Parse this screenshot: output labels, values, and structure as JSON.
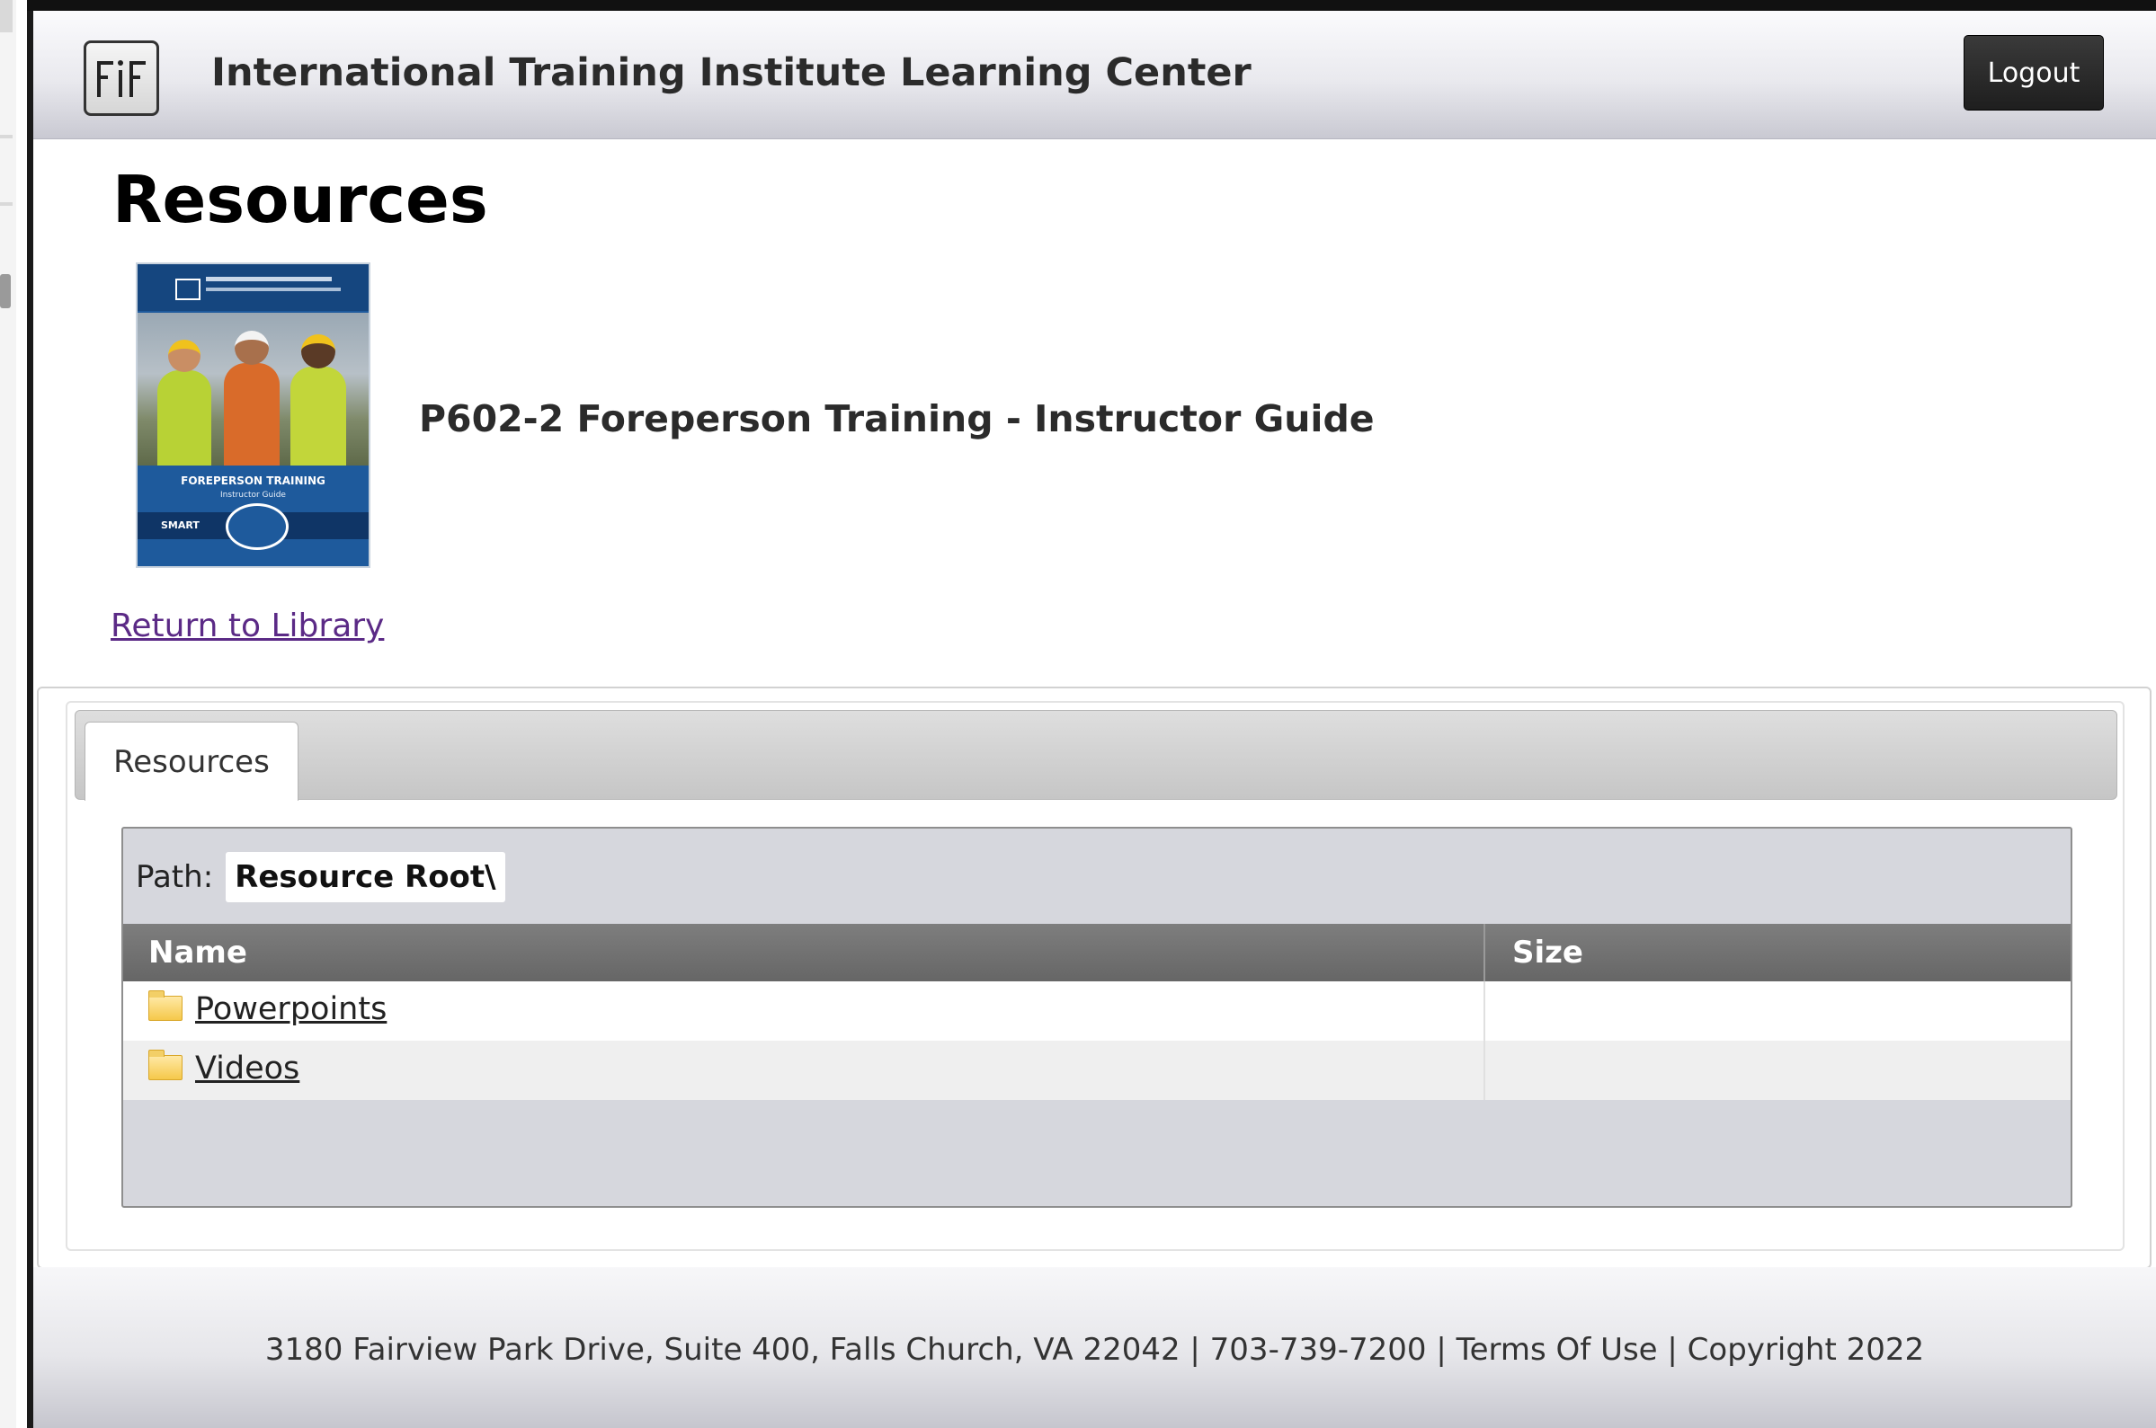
{
  "header": {
    "logo_text": "ITI",
    "title": "International Training Institute Learning Center",
    "logout_label": "Logout"
  },
  "page": {
    "title": "Resources",
    "book_title": "P602-2 Foreperson Training - Instructor Guide",
    "return_link": "Return to Library"
  },
  "cover": {
    "title": "FOREPERSON TRAINING",
    "subtitle": "Instructor Guide",
    "brand": "SMART"
  },
  "tabs": [
    {
      "label": "Resources",
      "active": true
    }
  ],
  "explorer": {
    "path_label": "Path:",
    "path_value": "Resource Root\\",
    "columns": [
      "Name",
      "Size"
    ],
    "rows": [
      {
        "name": "Powerpoints",
        "type": "folder",
        "size": ""
      },
      {
        "name": "Videos",
        "type": "folder",
        "size": ""
      }
    ]
  },
  "footer": {
    "text": "3180 Fairview Park Drive, Suite 400, Falls Church, VA 22042 | 703-739-7200 | Terms Of Use | Copyright 2022"
  }
}
